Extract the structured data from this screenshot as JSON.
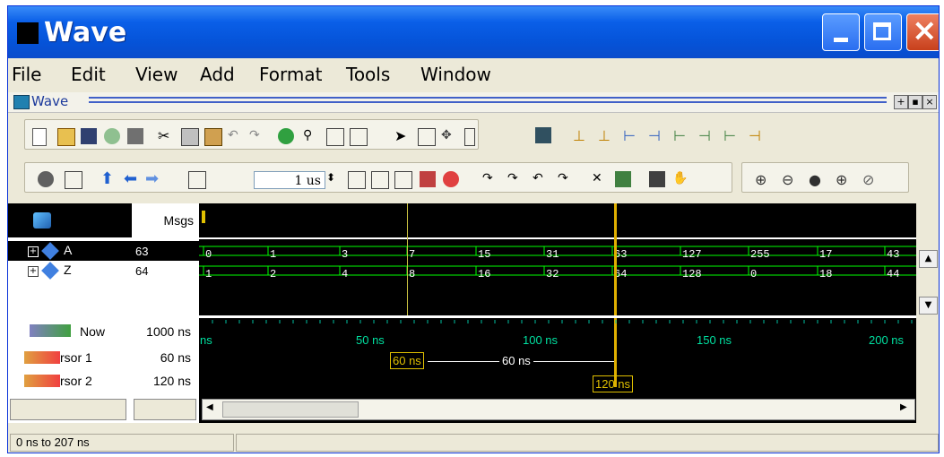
{
  "window": {
    "title": "Wave"
  },
  "menu": [
    "File",
    "Edit",
    "View",
    "Add",
    "Format",
    "Tools",
    "Window"
  ],
  "subwindow": {
    "title": "Wave"
  },
  "toolbar": {
    "time_value": "1 us"
  },
  "header": {
    "msgs_label": "Msgs"
  },
  "signals": [
    {
      "name": "A",
      "value": "63",
      "wave": [
        "0",
        "1",
        "3",
        "7",
        "15",
        "31",
        "63",
        "127",
        "255",
        "17",
        "43"
      ]
    },
    {
      "name": "Z",
      "value": "64",
      "wave": [
        "1",
        "2",
        "4",
        "8",
        "16",
        "32",
        "64",
        "128",
        "0",
        "18",
        "44"
      ]
    }
  ],
  "cursors": {
    "now_label": "Now",
    "now_value": "1000 ns",
    "cursor1_label": "rsor 1",
    "cursor1_value": "60 ns",
    "cursor2_label": "rsor 2",
    "cursor2_value": "120 ns",
    "ticks": [
      "ns",
      "50 ns",
      "100 ns",
      "150 ns",
      "200 ns"
    ],
    "c1_tag": "60 ns",
    "c2_tag": "120 ns",
    "delta": "60 ns"
  },
  "status": {
    "range": "0 ns to 207 ns"
  },
  "colors": {
    "wave": "#00ff00",
    "cursor": "#e0b000",
    "title_blue": "#0553d8"
  }
}
